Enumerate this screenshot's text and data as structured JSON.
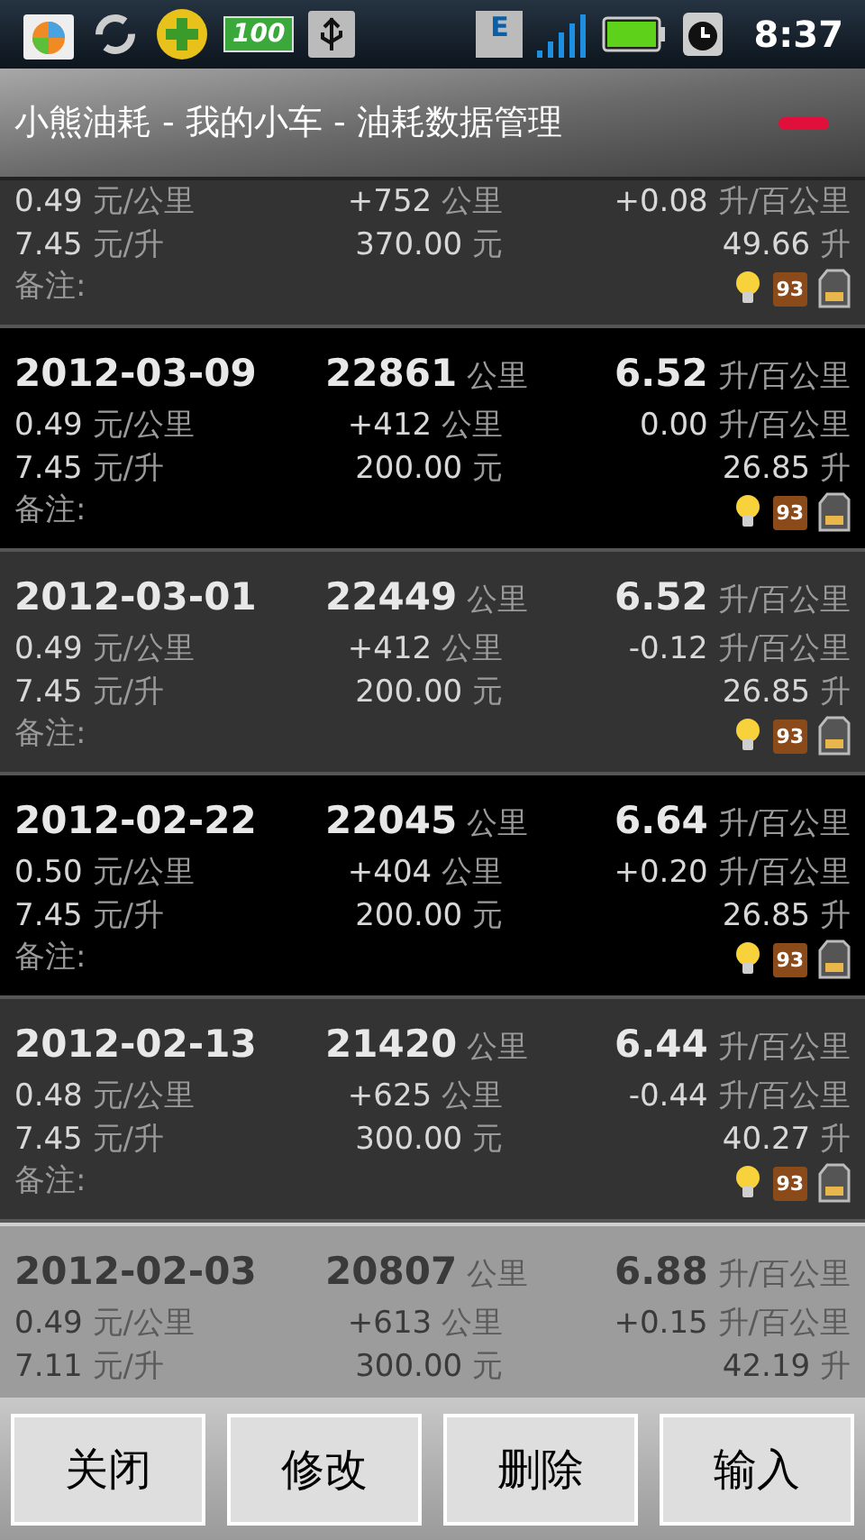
{
  "status_bar": {
    "time": "8:37",
    "battery_badge": "100",
    "network_badge": "E"
  },
  "title_bar": {
    "title": "小熊油耗 - 我的小车 - 油耗数据管理"
  },
  "records": [
    {
      "selected": false,
      "price_per_km": [
        "0.49",
        "元/公里"
      ],
      "distance": [
        "+752",
        "公里"
      ],
      "consumption_change": [
        "+0.08",
        "升/百公里"
      ],
      "fuel_price": [
        "7.45",
        "元/升"
      ],
      "cost": [
        "370.00",
        "元"
      ],
      "fuel_amount": [
        "49.66",
        "升"
      ],
      "note_label": "备注:",
      "fuel_grade": "93"
    },
    {
      "selected": false,
      "date": "2012-03-09",
      "odometer": [
        "22861",
        "公里"
      ],
      "consumption": [
        "6.52",
        "升/百公里"
      ],
      "price_per_km": [
        "0.49",
        "元/公里"
      ],
      "distance": [
        "+412",
        "公里"
      ],
      "consumption_change": [
        "0.00",
        "升/百公里"
      ],
      "fuel_price": [
        "7.45",
        "元/升"
      ],
      "cost": [
        "200.00",
        "元"
      ],
      "fuel_amount": [
        "26.85",
        "升"
      ],
      "note_label": "备注:",
      "fuel_grade": "93"
    },
    {
      "selected": false,
      "date": "2012-03-01",
      "odometer": [
        "22449",
        "公里"
      ],
      "consumption": [
        "6.52",
        "升/百公里"
      ],
      "price_per_km": [
        "0.49",
        "元/公里"
      ],
      "distance": [
        "+412",
        "公里"
      ],
      "consumption_change": [
        "-0.12",
        "升/百公里"
      ],
      "fuel_price": [
        "7.45",
        "元/升"
      ],
      "cost": [
        "200.00",
        "元"
      ],
      "fuel_amount": [
        "26.85",
        "升"
      ],
      "note_label": "备注:",
      "fuel_grade": "93"
    },
    {
      "selected": false,
      "date": "2012-02-22",
      "odometer": [
        "22045",
        "公里"
      ],
      "consumption": [
        "6.64",
        "升/百公里"
      ],
      "price_per_km": [
        "0.50",
        "元/公里"
      ],
      "distance": [
        "+404",
        "公里"
      ],
      "consumption_change": [
        "+0.20",
        "升/百公里"
      ],
      "fuel_price": [
        "7.45",
        "元/升"
      ],
      "cost": [
        "200.00",
        "元"
      ],
      "fuel_amount": [
        "26.85",
        "升"
      ],
      "note_label": "备注:",
      "fuel_grade": "93"
    },
    {
      "selected": false,
      "date": "2012-02-13",
      "odometer": [
        "21420",
        "公里"
      ],
      "consumption": [
        "6.44",
        "升/百公里"
      ],
      "price_per_km": [
        "0.48",
        "元/公里"
      ],
      "distance": [
        "+625",
        "公里"
      ],
      "consumption_change": [
        "-0.44",
        "升/百公里"
      ],
      "fuel_price": [
        "7.45",
        "元/升"
      ],
      "cost": [
        "300.00",
        "元"
      ],
      "fuel_amount": [
        "40.27",
        "升"
      ],
      "note_label": "备注:",
      "fuel_grade": "93"
    },
    {
      "selected": true,
      "date": "2012-02-03",
      "odometer": [
        "20807",
        "公里"
      ],
      "consumption": [
        "6.88",
        "升/百公里"
      ],
      "price_per_km": [
        "0.49",
        "元/公里"
      ],
      "distance": [
        "+613",
        "公里"
      ],
      "consumption_change": [
        "+0.15",
        "升/百公里"
      ],
      "fuel_price": [
        "7.11",
        "元/升"
      ],
      "cost": [
        "300.00",
        "元"
      ],
      "fuel_amount": [
        "42.19",
        "升"
      ]
    }
  ],
  "buttons": [
    "关闭",
    "修改",
    "删除",
    "输入"
  ]
}
